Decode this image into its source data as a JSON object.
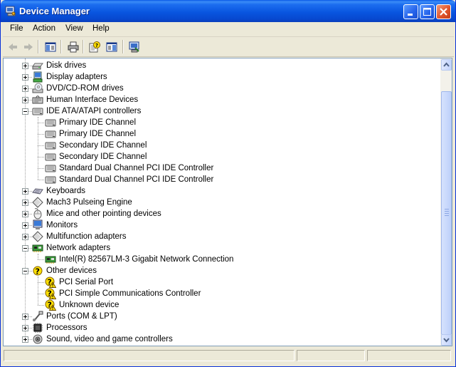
{
  "window": {
    "title": "Device Manager"
  },
  "menu": [
    "File",
    "Action",
    "View",
    "Help"
  ],
  "toolbar": {
    "buttons": [
      "back-arrow-icon",
      "forward-arrow-icon",
      "show-hide-console-tree-icon",
      "print-icon",
      "properties-help-icon",
      "action-pane-icon",
      "scan-hardware-icon"
    ]
  },
  "tree": {
    "items": [
      {
        "label": "Disk drives",
        "level": 0,
        "expander": "plus",
        "icon": "disk-drive-icon"
      },
      {
        "label": "Display adapters",
        "level": 0,
        "expander": "plus",
        "icon": "display-adapter-icon"
      },
      {
        "label": "DVD/CD-ROM drives",
        "level": 0,
        "expander": "plus",
        "icon": "dvd-drive-icon"
      },
      {
        "label": "Human Interface Devices",
        "level": 0,
        "expander": "plus",
        "icon": "hid-icon"
      },
      {
        "label": "IDE ATA/ATAPI controllers",
        "level": 0,
        "expander": "minus",
        "icon": "ide-controller-icon"
      },
      {
        "label": "Primary IDE Channel",
        "level": 1,
        "icon": "ide-controller-icon"
      },
      {
        "label": "Primary IDE Channel",
        "level": 1,
        "icon": "ide-controller-icon"
      },
      {
        "label": "Secondary IDE Channel",
        "level": 1,
        "icon": "ide-controller-icon"
      },
      {
        "label": "Secondary IDE Channel",
        "level": 1,
        "icon": "ide-controller-icon"
      },
      {
        "label": "Standard Dual Channel PCI IDE Controller",
        "level": 1,
        "icon": "ide-controller-icon"
      },
      {
        "label": "Standard Dual Channel PCI IDE Controller",
        "level": 1,
        "icon": "ide-controller-icon"
      },
      {
        "label": "Keyboards",
        "level": 0,
        "expander": "plus",
        "icon": "keyboard-icon"
      },
      {
        "label": "Mach3 Pulseing Engine",
        "level": 0,
        "expander": "plus",
        "icon": "generic-device-icon"
      },
      {
        "label": "Mice and other pointing devices",
        "level": 0,
        "expander": "plus",
        "icon": "mouse-icon"
      },
      {
        "label": "Monitors",
        "level": 0,
        "expander": "plus",
        "icon": "monitor-icon"
      },
      {
        "label": "Multifunction adapters",
        "level": 0,
        "expander": "plus",
        "icon": "generic-device-icon"
      },
      {
        "label": "Network adapters",
        "level": 0,
        "expander": "minus",
        "icon": "network-adapter-icon"
      },
      {
        "label": "Intel(R) 82567LM-3 Gigabit Network Connection",
        "level": 1,
        "icon": "network-adapter-icon"
      },
      {
        "label": "Other devices",
        "level": 0,
        "expander": "minus",
        "icon": "unknown-device-icon"
      },
      {
        "label": "PCI Serial Port",
        "level": 1,
        "icon": "unknown-device-warning-icon"
      },
      {
        "label": "PCI Simple Communications Controller",
        "level": 1,
        "icon": "unknown-device-warning-icon"
      },
      {
        "label": "Unknown device",
        "level": 1,
        "icon": "unknown-device-warning-icon"
      },
      {
        "label": "Ports (COM & LPT)",
        "level": 0,
        "expander": "plus",
        "icon": "port-icon"
      },
      {
        "label": "Processors",
        "level": 0,
        "expander": "plus",
        "icon": "processor-icon"
      },
      {
        "label": "Sound, video and game controllers",
        "level": 0,
        "expander": "plus",
        "icon": "sound-icon"
      }
    ]
  },
  "colors": {
    "titlebar": "#0a56e0",
    "tree_border": "#7f9db9",
    "warning": "#ffe000"
  }
}
